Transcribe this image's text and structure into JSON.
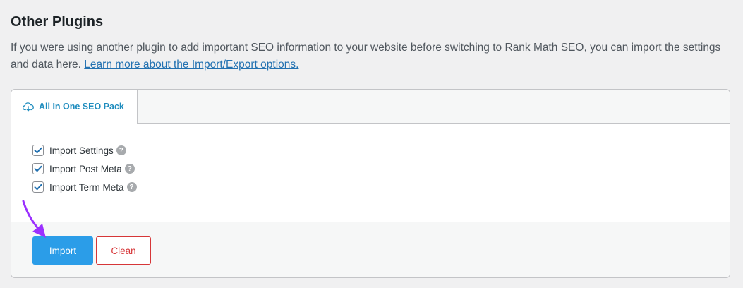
{
  "page": {
    "title": "Other Plugins",
    "description": "If you were using another plugin to add important SEO information to your website before switching to Rank Math SEO, you can import the settings and data here.",
    "learn_more_link": "Learn more about the Import/Export options."
  },
  "tabs": [
    {
      "label": "All In One SEO Pack",
      "icon": "cloud-download-icon",
      "active": true
    }
  ],
  "options": [
    {
      "label": "Import Settings",
      "checked": true
    },
    {
      "label": "Import Post Meta",
      "checked": true
    },
    {
      "label": "Import Term Meta",
      "checked": true
    }
  ],
  "help_glyph": "?",
  "buttons": {
    "import_label": "Import",
    "clean_label": "Clean"
  },
  "colors": {
    "accent": "#2b9de8",
    "link": "#2271b1",
    "danger": "#d63638",
    "annotation_arrow": "#9b30ff"
  }
}
